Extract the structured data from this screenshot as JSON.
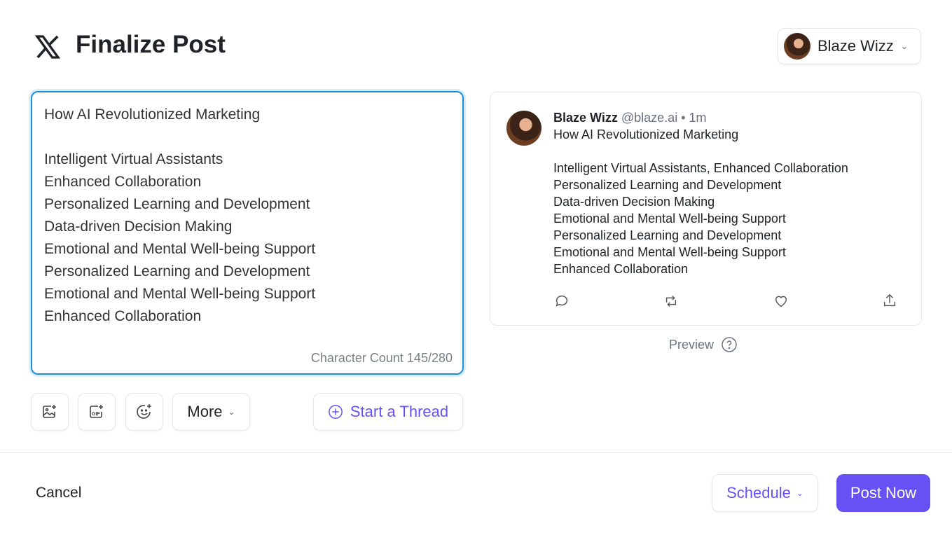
{
  "header": {
    "title": "Finalize Post",
    "logo": "x-logo-icon",
    "account_name": "Blaze Wizz"
  },
  "editor": {
    "lines": [
      "How AI Revolutionized Marketing",
      "",
      "Intelligent Virtual Assistants",
      "Enhanced Collaboration",
      "Personalized Learning and Development",
      "Data-driven Decision Making",
      "Emotional and Mental Well-being Support",
      "Personalized Learning and Development",
      "Emotional and Mental Well-being Support",
      "Enhanced Collaboration"
    ],
    "char_count": "Character Count 145/280"
  },
  "toolbar": {
    "more_label": "More",
    "thread_label": "Start a Thread"
  },
  "preview": {
    "name": "Blaze Wizz",
    "handle": "@blaze.ai",
    "time": "• 1m",
    "lines": [
      "How AI Revolutionized Marketing",
      "",
      "Intelligent Virtual Assistants, Enhanced Collaboration",
      "Personalized Learning and Development",
      "Data-driven Decision Making",
      "Emotional and Mental Well-being Support",
      "Personalized Learning and Development",
      "Emotional and Mental Well-being Support",
      "Enhanced Collaboration"
    ],
    "label": "Preview"
  },
  "footer": {
    "cancel": "Cancel",
    "schedule": "Schedule",
    "post_now": "Post Now"
  },
  "colors": {
    "accent": "#6651f5",
    "focus": "#1d8fd6"
  }
}
